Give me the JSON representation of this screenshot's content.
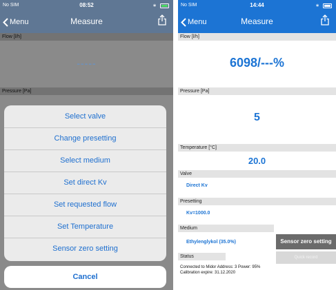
{
  "left": {
    "status": {
      "carrier": "No SIM",
      "time": "08:52",
      "bluetooth": "∗"
    },
    "nav": {
      "back": "Menu",
      "title": "Measure"
    },
    "flow_label": "Flow [l/h]",
    "flow_value": "-----",
    "pressure_label": "Pressure [Pa]",
    "sheet_items": [
      "Select valve",
      "Change presetting",
      "Select medium",
      "Set direct Kv",
      "Set requested flow",
      "Set Temperature",
      "Sensor zero setting"
    ],
    "cancel": "Cancel"
  },
  "right": {
    "status": {
      "carrier": "No SIM",
      "time": "14:44",
      "bluetooth": "∗"
    },
    "nav": {
      "back": "Menu",
      "title": "Measure"
    },
    "flow_label": "Flow [l/h]",
    "flow_value": "6098/---%",
    "pressure_label": "Pressure [Pa]",
    "pressure_value": "5",
    "temperature_label": "Temperature [°C]",
    "temperature_value": "20.0",
    "valve_label": "Valve",
    "valve_value": "Direct Kv",
    "presetting_label": "Presetting",
    "presetting_value": "Kv=1000.0",
    "medium_label": "Medium",
    "medium_value": "Ethylenglykol (35.0%)",
    "status_label": "Status",
    "status_text": "Connected to Midor Address: 3 Power: 95% Calibration expire: 31.12.2020",
    "sensor_zero_button": "Sensor zero setting",
    "quick_record_button": "Quick record"
  },
  "colors": {
    "left_bar": "#5f7794",
    "right_bar": "#1c74d4",
    "action_blue": "#1e6fcf"
  },
  "icons": {
    "back": "chevron-left-icon",
    "share": "share-icon"
  }
}
